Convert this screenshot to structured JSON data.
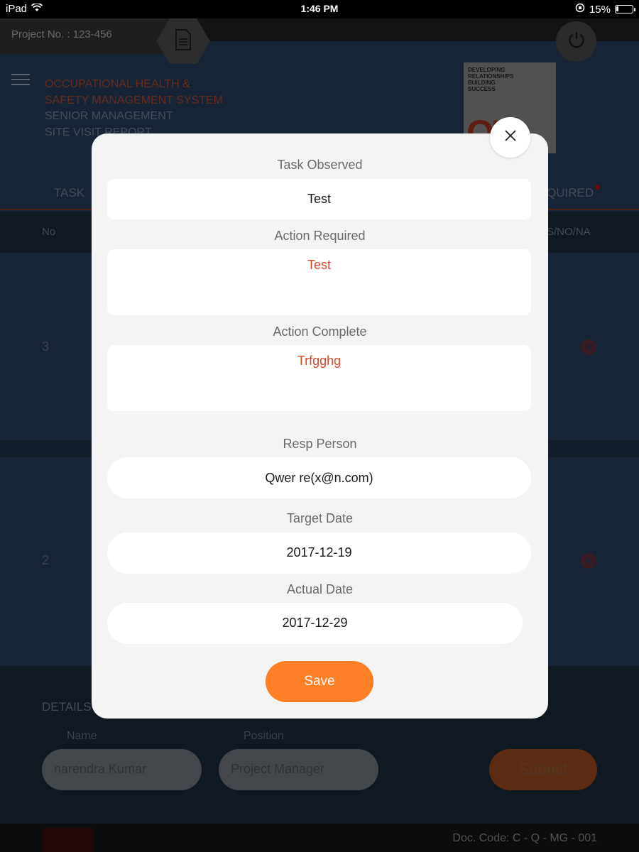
{
  "status_bar": {
    "device": "iPad",
    "time": "1:46 PM",
    "battery_text": "15%",
    "battery_level": 0.15
  },
  "header": {
    "project_no": "Project No. : 123-456",
    "title_lines": [
      "OCCUPATIONAL HEALTH &",
      "SAFETY MANAGEMENT SYSTEM",
      "SENIOR MANAGEMENT",
      "SITE VISIT REPORT"
    ],
    "logo_text": "DEVELOPING\nRELATIONSHIPS\nBUILDING\nSUCCESS",
    "logo_mark": "OIP"
  },
  "table": {
    "tab_left": "TASK",
    "tab_right": "QUIRED",
    "header_no": "No",
    "header_status": "S/NO/NA",
    "rows": [
      {
        "no": "3"
      },
      {
        "no": "2"
      }
    ]
  },
  "details": {
    "label": "DETAILS",
    "name_label": "Name",
    "position_label": "Position",
    "name_value": "narendra Kumar",
    "position_value": "Project Manager",
    "submit_label": "Submit"
  },
  "footer": {
    "doc_code": "Doc. Code: C - Q - MG - 001"
  },
  "modal": {
    "task_observed_label": "Task Observed",
    "task_observed_value": "Test",
    "action_required_label": "Action Required",
    "action_required_value": "Test",
    "action_complete_label": "Action Complete",
    "action_complete_value": "Trfgghg",
    "resp_person_label": "Resp Person",
    "resp_person_value": "Qwer re(x@n.com)",
    "target_date_label": "Target Date",
    "target_date_value": "2017-12-19",
    "actual_date_label": "Actual Date",
    "actual_date_value": "2017-12-29",
    "save_label": "Save"
  },
  "colors": {
    "accent": "#fe7f26",
    "alert_text": "#d9472b",
    "modal_bg": "#f4f4f4"
  },
  "icons": [
    "wifi-icon",
    "document-icon",
    "power-icon",
    "menu-icon",
    "close-icon",
    "remove-icon",
    "orientation-lock-icon"
  ]
}
